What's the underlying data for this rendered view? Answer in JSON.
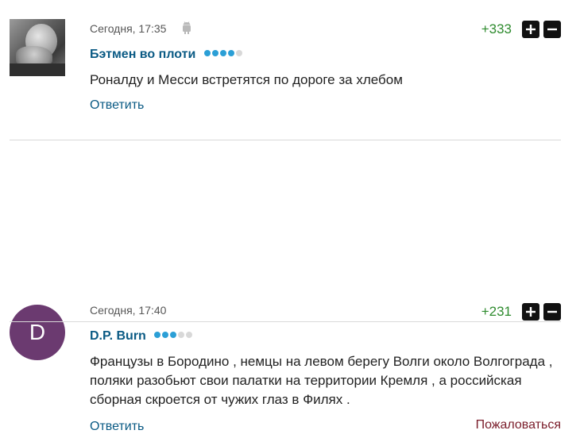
{
  "comments": [
    {
      "timestamp": "Сегодня, 17:35",
      "device_icon": "android-icon",
      "author": "Бэтмен во плоти",
      "rating_dots": 4,
      "text": "Роналду и Месси встретятся по дороге за хлебом",
      "score": "+333",
      "reply_label": "Ответить"
    },
    {
      "avatar_letter": "D",
      "avatar_color": "#6b3a70",
      "timestamp": "Сегодня, 17:40",
      "author": "D.P. Burn",
      "rating_dots": 3,
      "text": "Французы в Бородино , немцы на левом берегу Волги около Волгограда , поляки разобьют свои палатки на территории Кремля , а российская сборная скроется от чужих глаз в Филях .",
      "score": "+231",
      "reply_label": "Ответить",
      "report_label": "Пожаловаться"
    }
  ],
  "colors": {
    "author": "#0a5a84",
    "score": "#2e8b2e",
    "dot_on": "#2b9fd6",
    "dot_off": "#d8d8d8",
    "report": "#7a1c2a"
  }
}
